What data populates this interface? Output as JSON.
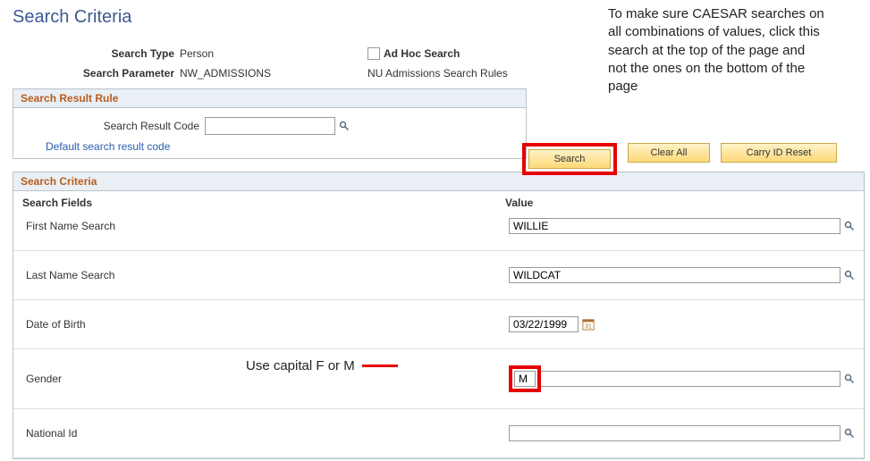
{
  "page_title": "Search Criteria",
  "meta": {
    "search_type_label": "Search Type",
    "search_type_value": "Person",
    "search_parameter_label": "Search Parameter",
    "search_parameter_value": "NW_ADMISSIONS",
    "ad_hoc_label": "Ad Hoc Search",
    "rules_text": "NU Admissions Search Rules"
  },
  "result_rule": {
    "header": "Search Result Rule",
    "code_label": "Search Result Code",
    "code_value": "",
    "default_link": "Default search result code"
  },
  "buttons": {
    "search": "Search",
    "clear_all": "Clear All",
    "carry_id_reset": "Carry ID Reset"
  },
  "annotations": {
    "top": "To make sure CAESAR searches on all combinations of values, click this search at the top of the page and not the ones on the bottom of the page",
    "gender": "Use capital F or M"
  },
  "criteria": {
    "header": "Search Criteria",
    "col_fields": "Search Fields",
    "col_value": "Value",
    "rows": {
      "first_name": {
        "label": "First Name Search",
        "value": "WILLIE"
      },
      "last_name": {
        "label": "Last Name Search",
        "value": "WILDCAT"
      },
      "dob": {
        "label": "Date of Birth",
        "value": "03/22/1999"
      },
      "gender": {
        "label": "Gender",
        "value": "M"
      },
      "national_id": {
        "label": "National Id",
        "value": ""
      }
    }
  }
}
